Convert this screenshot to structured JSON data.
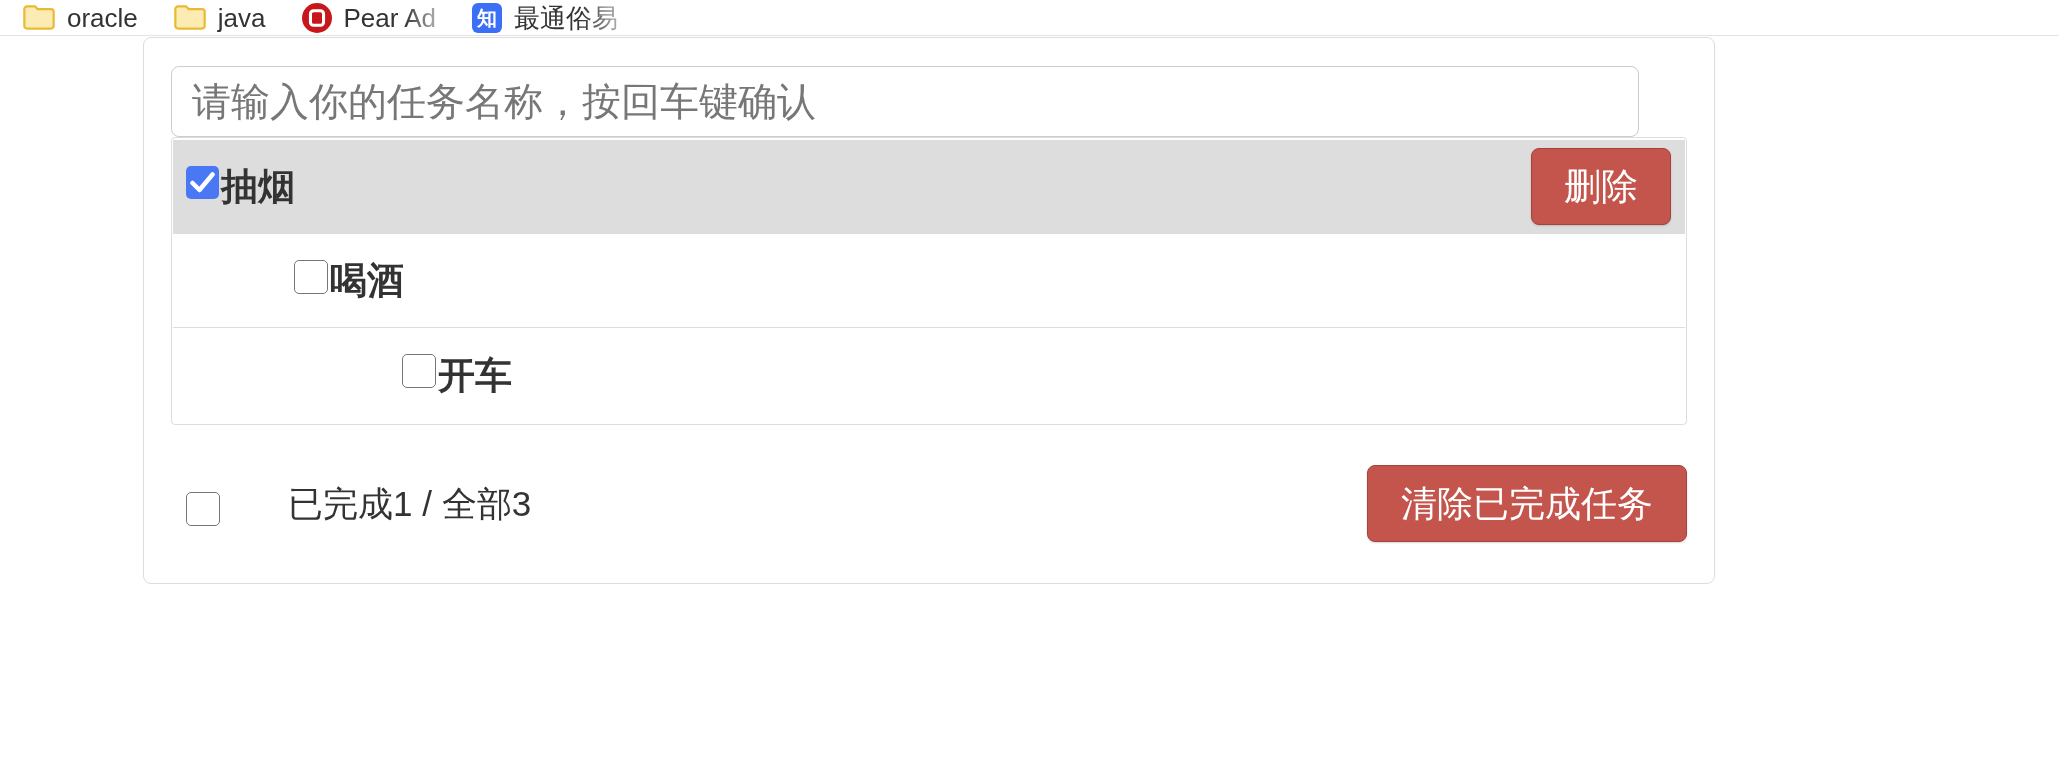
{
  "bookmarks": [
    {
      "kind": "folder",
      "label": "oracle",
      "truncated": false
    },
    {
      "kind": "folder",
      "label": "java",
      "truncated": false
    },
    {
      "kind": "circle-logo",
      "label": "Pear Ad",
      "truncated": true
    },
    {
      "kind": "tile-logo",
      "logo_text": "知",
      "label": "最通俗易",
      "truncated": true
    }
  ],
  "todo": {
    "input": {
      "placeholder": "请输入你的任务名称，按回车键确认"
    },
    "items": [
      {
        "label": "抽烟",
        "checked": true,
        "highlighted": true,
        "delete_button": "删除",
        "children": [
          {
            "label": "喝酒",
            "checked": false,
            "highlighted": false,
            "children": [
              {
                "label": "开车",
                "checked": false,
                "highlighted": false
              }
            ]
          }
        ]
      }
    ],
    "footer": {
      "select_all": {
        "checked": false
      },
      "summary": "已完成1 / 全部3",
      "clear_button": "清除已完成任务"
    }
  }
}
